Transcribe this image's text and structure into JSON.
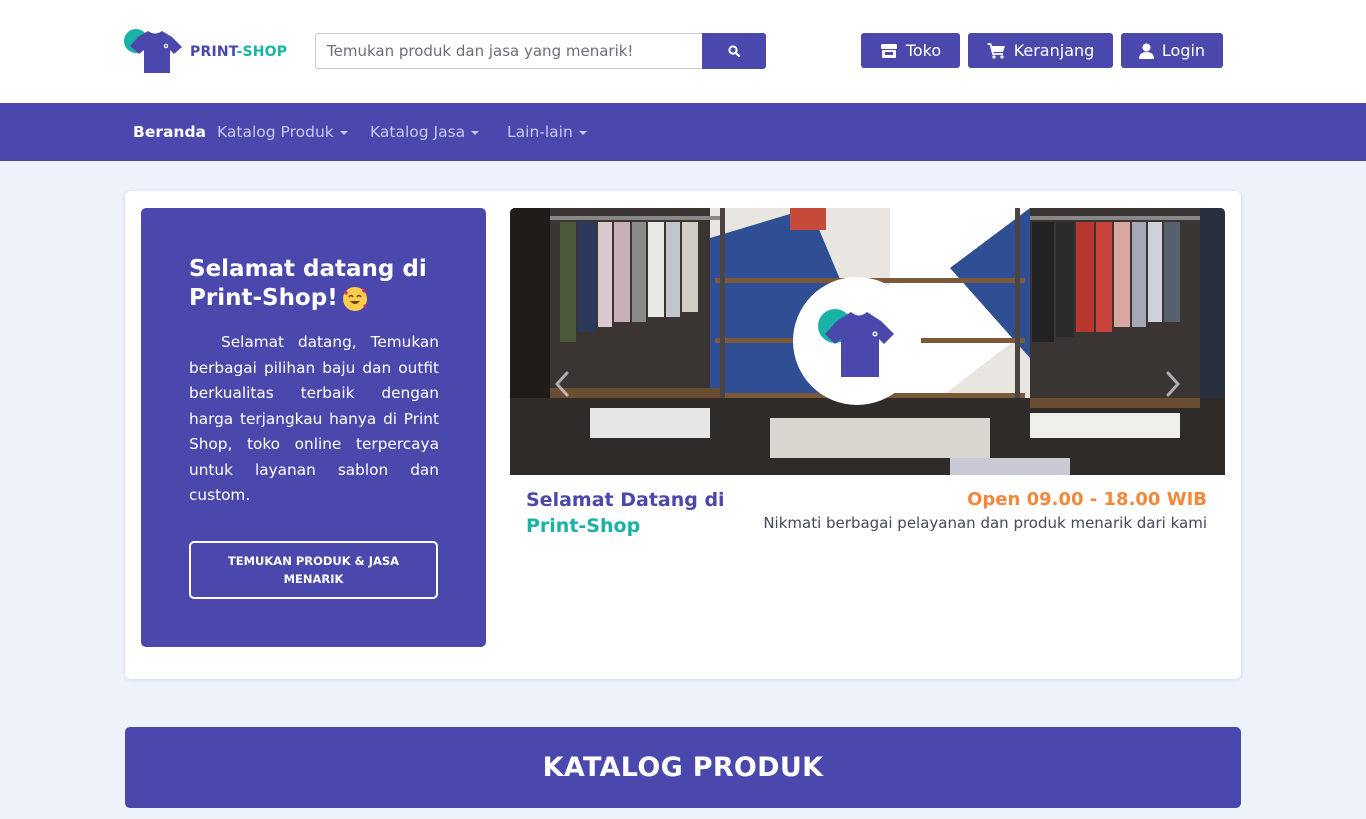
{
  "brand": {
    "part1": "PRINT",
    "part2": "-SHOP"
  },
  "colors": {
    "primary": "#4b48ad",
    "accent_teal": "#19b3a6",
    "accent_orange": "#f3883b",
    "background": "#eef2fb"
  },
  "search": {
    "placeholder": "Temukan produk dan jasa yang menarik!",
    "icon": "search-icon"
  },
  "header_buttons": [
    {
      "label": "Toko",
      "icon": "store-icon"
    },
    {
      "label": "Keranjang",
      "icon": "cart-icon"
    },
    {
      "label": "Login",
      "icon": "user-icon"
    }
  ],
  "nav": {
    "items": [
      {
        "label": "Beranda",
        "active": true
      },
      {
        "label": "Katalog Produk",
        "dropdown": true
      },
      {
        "label": "Katalog Jasa",
        "dropdown": true
      },
      {
        "label": "Lain-lain",
        "dropdown": true
      }
    ]
  },
  "welcome": {
    "title": "Selamat datang di Print-Shop!",
    "title_emoji": "smiling-face-with-hearts-icon",
    "body": "Selamat datang, Temukan berbagai pilihan baju dan outfit berkualitas terbaik dengan harga terjangkau hanya di Print Shop, toko online terpercaya untuk layanan sablon dan custom.",
    "cta": "TEMUKAN PRODUK & JASA MENARIK"
  },
  "carousel": {
    "caption_left_1": "Selamat Datang di",
    "caption_left_2": "Print-Shop",
    "hours": "Open 09.00 - 18.00 WIB",
    "subtitle": "Nikmati berbagai pelayanan dan produk menarik dari kami"
  },
  "katalog": {
    "title": "KATALOG PRODUK"
  }
}
